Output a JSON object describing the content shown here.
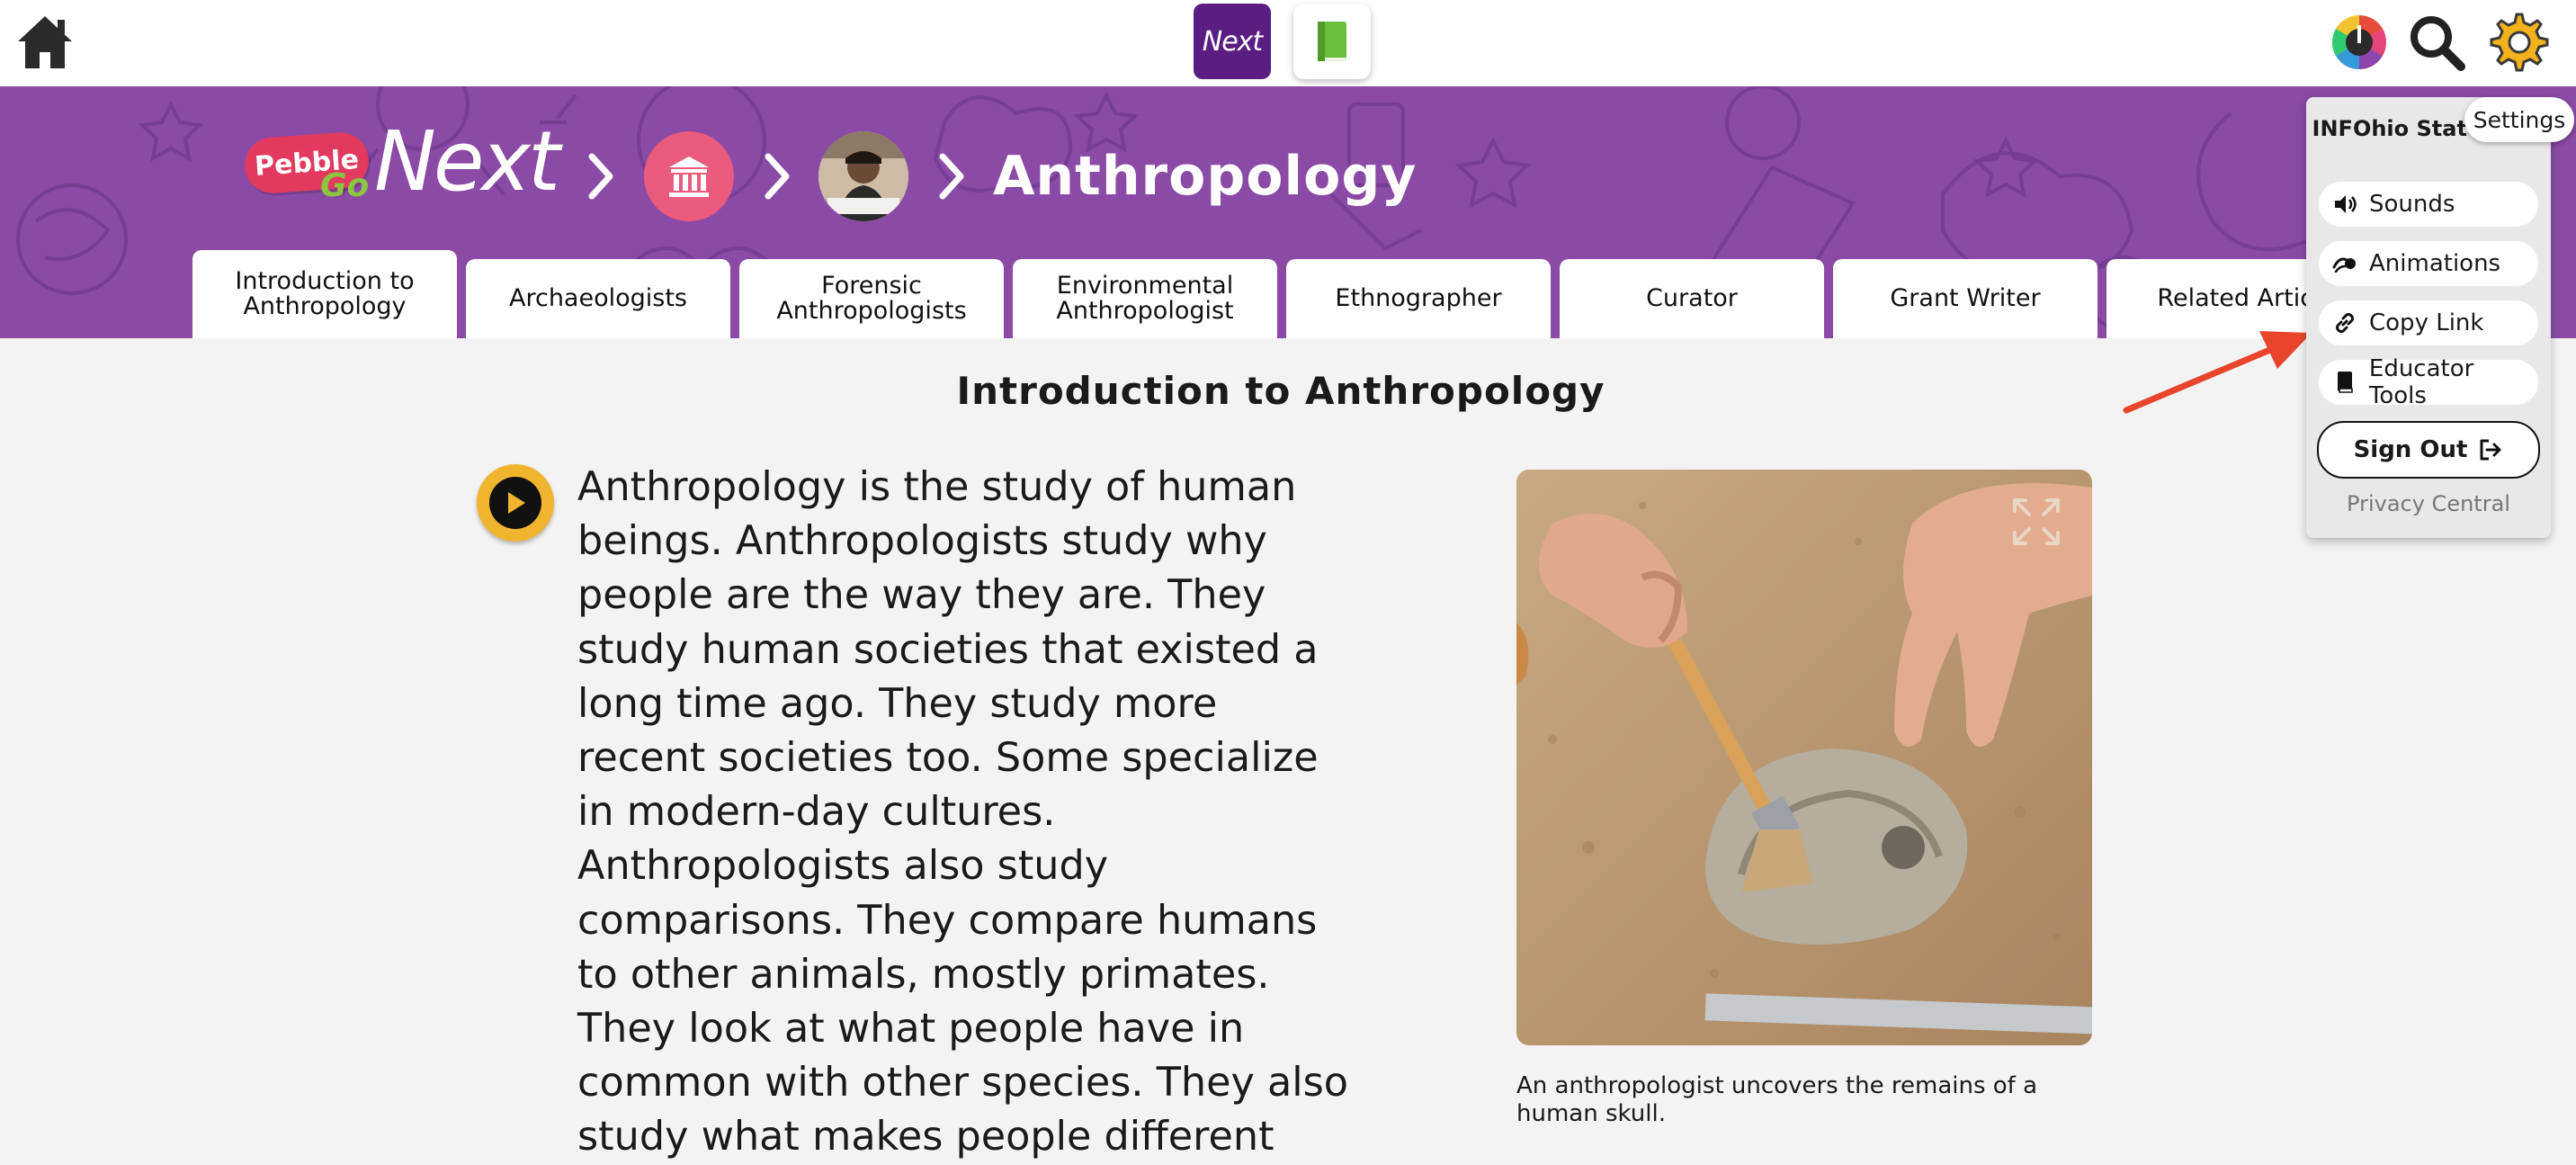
{
  "topbar": {
    "next_label": "Next",
    "icons": [
      "home-icon",
      "book-icon",
      "color-wheel-icon",
      "search-icon",
      "gear-icon"
    ]
  },
  "banner": {
    "logo_pebble": "Pebble",
    "logo_go": "Go",
    "logo_next": "Next",
    "breadcrumb_title": "Anthropology",
    "color": "#8a4aa5"
  },
  "tabs": [
    {
      "label": "Introduction to Anthropology",
      "active": true
    },
    {
      "label": "Archaeologists",
      "active": false
    },
    {
      "label": "Forensic Anthropologists",
      "active": false
    },
    {
      "label": "Environmental Anthropologist",
      "active": false
    },
    {
      "label": "Ethnographer",
      "active": false
    },
    {
      "label": "Curator",
      "active": false
    },
    {
      "label": "Grant Writer",
      "active": false
    },
    {
      "label": "Related Articl",
      "active": false
    }
  ],
  "article": {
    "heading": "Introduction to Anthropology",
    "body": "Anthropology is the study of human beings. Anthropologists study why people are the way they are. They study human societies that existed a long time ago. They study more recent societies too. Some specialize in modern-day cultures. Anthropologists also study comparisons. They compare humans to other animals, mostly primates. They look at what people have in common with other species. They also study what makes people different",
    "caption": "An anthropologist uncovers the remains of a human skull."
  },
  "settings": {
    "tooltip": "Settings",
    "user_name": "INFOhio State User",
    "items": [
      {
        "label": "Sounds",
        "icon": "speaker-icon"
      },
      {
        "label": "Animations",
        "icon": "animation-icon"
      },
      {
        "label": "Copy Link",
        "icon": "link-icon"
      },
      {
        "label": "Educator Tools",
        "icon": "book-icon"
      }
    ],
    "sign_out": "Sign Out",
    "privacy": "Privacy Central"
  },
  "colors": {
    "accent_purple": "#5a1e82",
    "banner_purple": "#8a4aa5",
    "play_yellow": "#f1b42f",
    "arrow_red": "#e8452c"
  }
}
